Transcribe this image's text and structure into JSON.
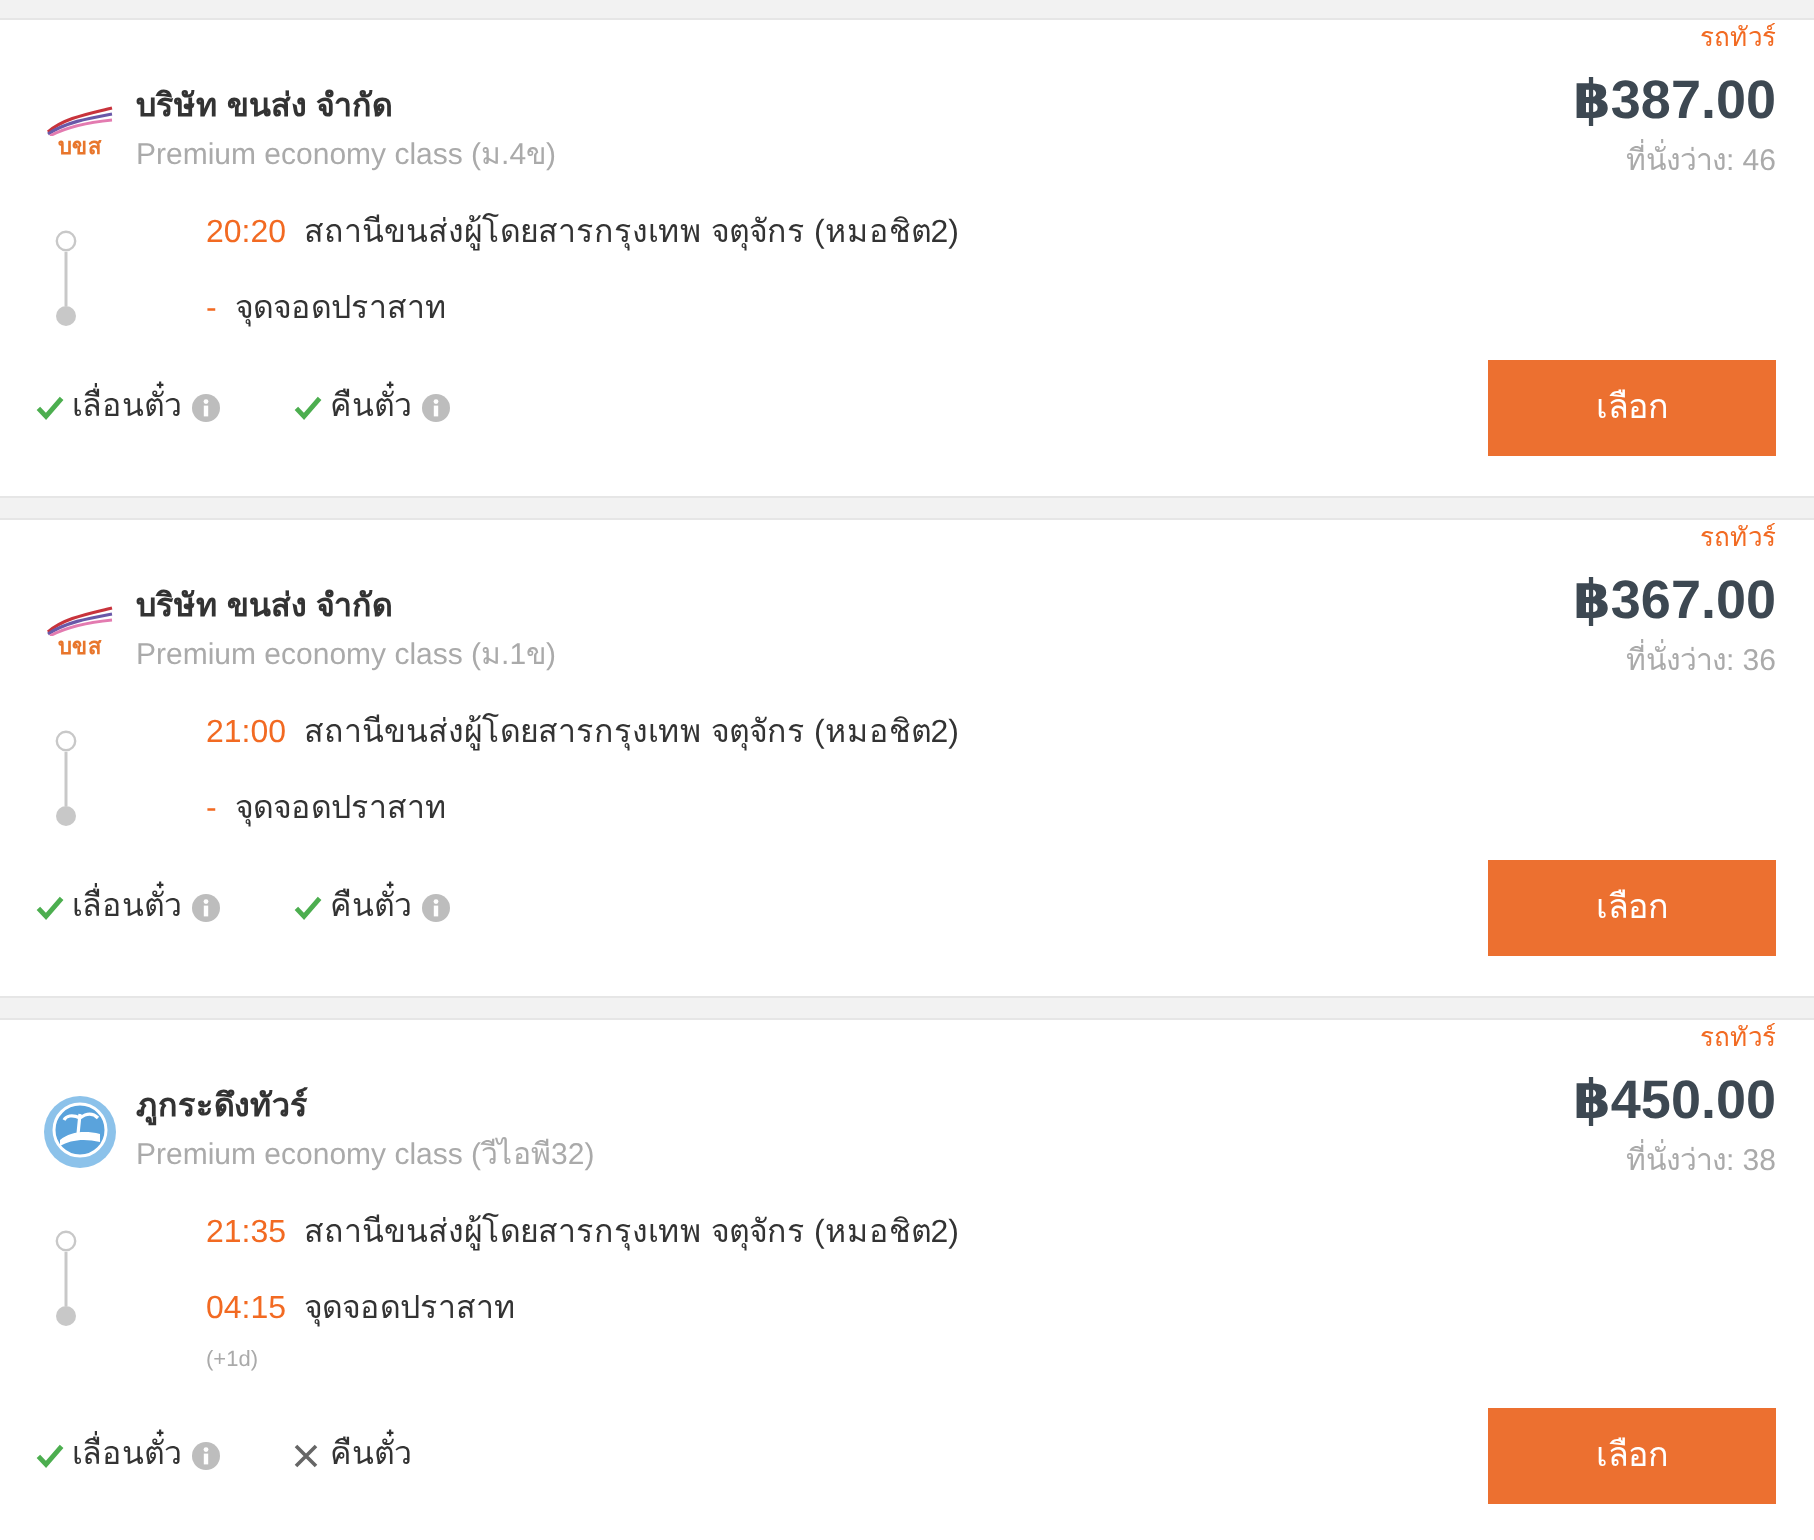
{
  "trips": [
    {
      "vehicle_type": "รถทัวร์",
      "logo": {
        "kind": "swoosh",
        "text": "บขส"
      },
      "operator": "บริษัท ขนส่ง จำกัด",
      "service_class": "Premium economy class (ม.4ข)",
      "price": "฿387.00",
      "seats": "ที่นั่งว่าง: 46",
      "stops": [
        {
          "time": "20:20",
          "place": "สถานีขนส่งผู้โดยสารกรุงเทพ จตุจักร (หมอชิต2)"
        },
        {
          "time": "-",
          "place": "จุดจอดปราสาท"
        }
      ],
      "features": [
        {
          "label": "เลื่อนตั๋ว",
          "available": true,
          "info": true
        },
        {
          "label": "คืนตั๋ว",
          "available": true,
          "info": true
        }
      ],
      "button": "เลือก"
    },
    {
      "vehicle_type": "รถทัวร์",
      "logo": {
        "kind": "swoosh",
        "text": "บขส"
      },
      "operator": "บริษัท ขนส่ง จำกัด",
      "service_class": "Premium economy class (ม.1ข)",
      "price": "฿367.00",
      "seats": "ที่นั่งว่าง: 36",
      "stops": [
        {
          "time": "21:00",
          "place": "สถานีขนส่งผู้โดยสารกรุงเทพ จตุจักร (หมอชิต2)"
        },
        {
          "time": "-",
          "place": "จุดจอดปราสาท"
        }
      ],
      "features": [
        {
          "label": "เลื่อนตั๋ว",
          "available": true,
          "info": true
        },
        {
          "label": "คืนตั๋ว",
          "available": true,
          "info": true
        }
      ],
      "button": "เลือก"
    },
    {
      "vehicle_type": "รถทัวร์",
      "logo": {
        "kind": "emblem"
      },
      "operator": "ภูกระดึงทัวร์",
      "service_class": "Premium economy class (วีไอพี32)",
      "price": "฿450.00",
      "seats": "ที่นั่งว่าง: 38",
      "stops": [
        {
          "time": "21:35",
          "place": "สถานีขนส่งผู้โดยสารกรุงเทพ จตุจักร (หมอชิต2)"
        },
        {
          "time": "04:15",
          "place": "จุดจอดปราสาท",
          "note": "(+1d)"
        }
      ],
      "features": [
        {
          "label": "เลื่อนตั๋ว",
          "available": true,
          "info": true
        },
        {
          "label": "คืนตั๋ว",
          "available": false,
          "info": false
        }
      ],
      "button": "เลือก"
    }
  ]
}
